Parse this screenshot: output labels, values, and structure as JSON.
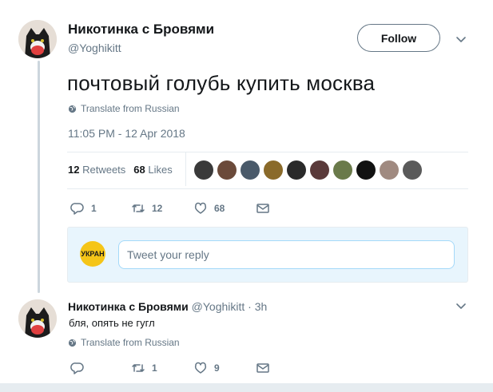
{
  "tweet": {
    "author_name": "Никотинка с Бровями",
    "author_handle": "@Yoghikitt",
    "follow_label": "Follow",
    "text": "почтовый голубь купить москва",
    "translate_label": "Translate from Russian",
    "timestamp": "11:05 PM - 12 Apr 2018",
    "retweets_count": "12",
    "retweets_label": "Retweets",
    "likes_count": "68",
    "likes_label": "Likes",
    "actions": {
      "reply_count": "1",
      "retweet_count": "12",
      "like_count": "68"
    }
  },
  "likers": [
    {
      "color": "#3a3a3a"
    },
    {
      "color": "#6b4a3a"
    },
    {
      "color": "#4a5a6a"
    },
    {
      "color": "#8a6a2a"
    },
    {
      "color": "#2a2a2a"
    },
    {
      "color": "#5a3a3a"
    },
    {
      "color": "#6a7a4a"
    },
    {
      "color": "#111111"
    },
    {
      "color": "#a08a80"
    },
    {
      "color": "#5a5a5a"
    }
  ],
  "compose": {
    "avatar_text": "УКРАН",
    "placeholder": "Tweet your reply"
  },
  "reply": {
    "author_name": "Никотинка с Бровями",
    "author_handle": "@Yoghikitt",
    "time": "· 3h",
    "text": "бля, опять не гугл",
    "translate_label": "Translate from Russian",
    "actions": {
      "retweet_count": "1",
      "like_count": "9"
    }
  },
  "colors": {
    "accent": "#1da1f2",
    "muted": "#657786",
    "reply_box_bg": "#e8f5fd"
  }
}
